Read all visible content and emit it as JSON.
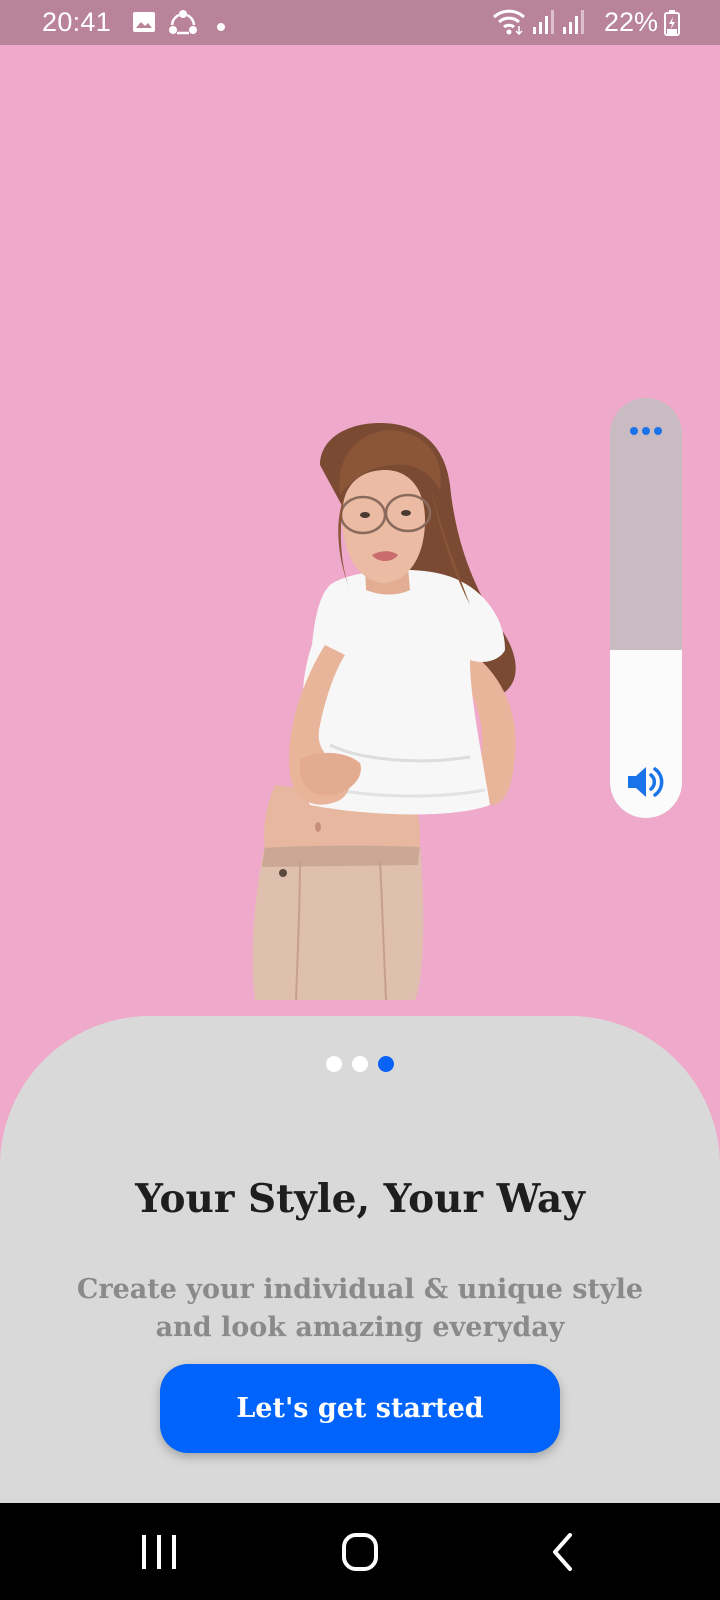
{
  "status_bar": {
    "time": "20:41",
    "battery_percent": "22%",
    "icons": [
      "gallery-icon",
      "share-sync-icon",
      "notification-dot-icon",
      "wifi-icon",
      "signal-icon",
      "signal-icon",
      "battery-charging-icon"
    ]
  },
  "volume_overlay": {
    "level": 0.4,
    "more_icon": "more-options-icon",
    "speaker_icon": "speaker-icon",
    "accent_color": "#1a73e8"
  },
  "onboarding": {
    "page_indicator": {
      "total": 3,
      "active_index": 2
    },
    "title": "Your Style, Your Way",
    "subtitle": "Create your individual & unique style and look amazing everyday",
    "cta_label": "Let's get started",
    "cta_color": "#0063fb",
    "background_color": "#efa9cb"
  },
  "nav_bar": {
    "icons": [
      "recent-apps-icon",
      "home-icon",
      "back-icon"
    ]
  }
}
